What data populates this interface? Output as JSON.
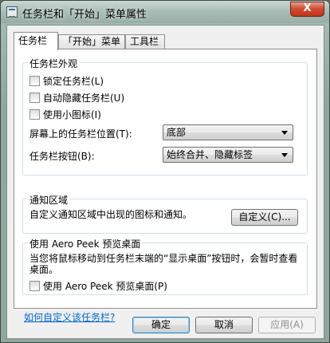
{
  "window": {
    "title": "任务栏和「开始」菜单属性",
    "close_label": "X"
  },
  "tabs": [
    {
      "label": "任务栏"
    },
    {
      "label": "「开始」菜单"
    },
    {
      "label": "工具栏"
    }
  ],
  "appearance": {
    "title": "任务栏外观",
    "lock_label": "锁定任务栏(L)",
    "autohide_label": "自动隐藏任务栏(U)",
    "small_icons_label": "使用小图标(I)",
    "location_label": "屏幕上的任务栏位置(T):",
    "location_value": "底部",
    "buttons_label": "任务栏按钮(B):",
    "buttons_value": "始终合并、隐藏标签"
  },
  "notification": {
    "title": "通知区域",
    "description": "自定义通知区域中出现的图标和通知。",
    "customize_button": "自定义(C)..."
  },
  "aero_peek": {
    "title": "使用 Aero Peek 预览桌面",
    "description": "当您将鼠标移动到任务栏末端的“显示桌面”按钮时，会暂时查看桌面。",
    "checkbox_label": "使用 Aero Peek 预览桌面(P)"
  },
  "help_link": "如何自定义该任务栏?",
  "buttons": {
    "ok": "确定",
    "cancel": "取消",
    "apply": "应用(A)"
  }
}
